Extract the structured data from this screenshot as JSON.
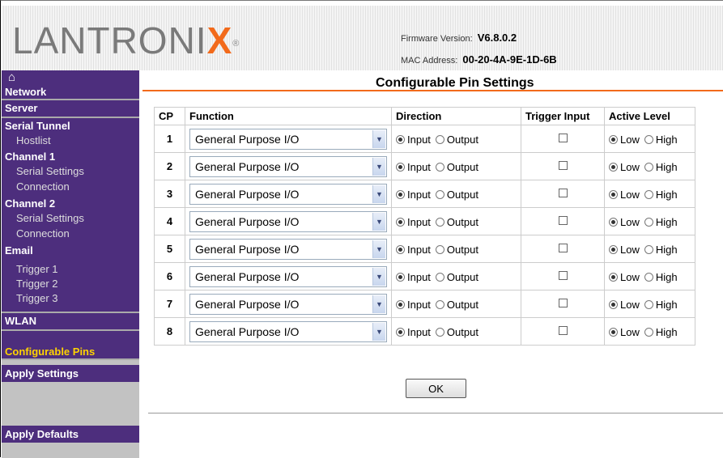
{
  "header": {
    "logo_main": "LANTRONI",
    "logo_x": "X",
    "logo_reg": "®",
    "firmware_label": "Firmware Version:",
    "firmware_value": "V6.8.0.2",
    "mac_label": "MAC Address:",
    "mac_value": "00-20-4A-9E-1D-6B"
  },
  "sidebar": {
    "home_icon": "⌂",
    "network": "Network",
    "server": "Server",
    "serial_tunnel": "Serial Tunnel",
    "hostlist": "Hostlist",
    "channel1": "Channel 1",
    "ch1_serial": "Serial Settings",
    "ch1_connection": "Connection",
    "channel2": "Channel 2",
    "ch2_serial": "Serial Settings",
    "ch2_connection": "Connection",
    "email": "Email",
    "trigger1": "Trigger 1",
    "trigger2": "Trigger 2",
    "trigger3": "Trigger 3",
    "wlan": "WLAN",
    "configurable_pins": "Configurable Pins",
    "apply_settings": "Apply Settings",
    "apply_defaults": "Apply Defaults"
  },
  "main": {
    "title": "Configurable Pin Settings",
    "columns": [
      "CP",
      "Function",
      "Direction",
      "Trigger Input",
      "Active Level"
    ],
    "input_label": "Input",
    "output_label": "Output",
    "low_label": "Low",
    "high_label": "High",
    "ok_label": "OK",
    "rows": [
      {
        "cp": "1",
        "function": "General Purpose I/O"
      },
      {
        "cp": "2",
        "function": "General Purpose I/O"
      },
      {
        "cp": "3",
        "function": "General Purpose I/O"
      },
      {
        "cp": "4",
        "function": "General Purpose I/O"
      },
      {
        "cp": "5",
        "function": "General Purpose I/O"
      },
      {
        "cp": "6",
        "function": "General Purpose I/O"
      },
      {
        "cp": "7",
        "function": "General Purpose I/O"
      },
      {
        "cp": "8",
        "function": "General Purpose I/O"
      }
    ]
  },
  "colors": {
    "accent": "#f26a1b",
    "nav_purple": "#4d2e7d",
    "active_nav": "#ffd400"
  }
}
